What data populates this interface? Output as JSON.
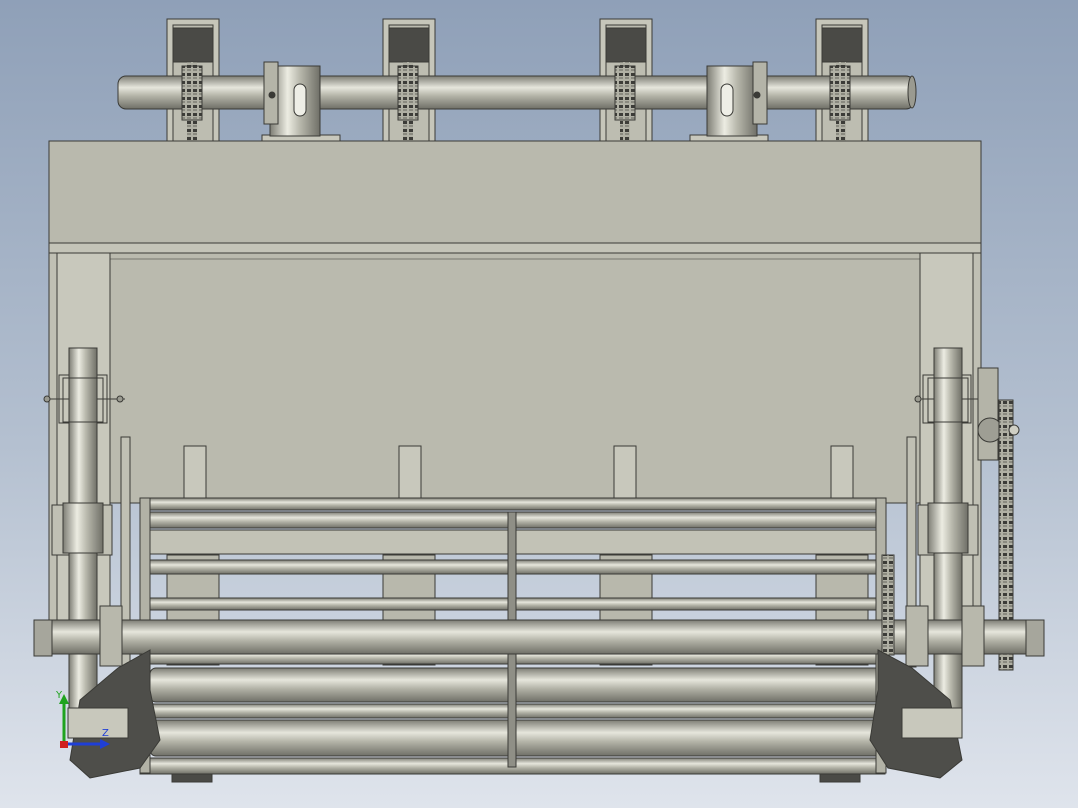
{
  "viewport": {
    "background_top": "#8fa0b8",
    "background_bottom": "#dfe4ec"
  },
  "model": {
    "description_icon": "machine-assembly-front-view",
    "metal_color": "#b9b9ad",
    "edge_color": "#3a3a36",
    "dark_part_color": "#4a4a46"
  },
  "triad": {
    "y_label": "Y",
    "z_label": "Z",
    "y_color": "#1fa31f",
    "z_color": "#1f3fd6",
    "x_color": "#d01f1f"
  }
}
